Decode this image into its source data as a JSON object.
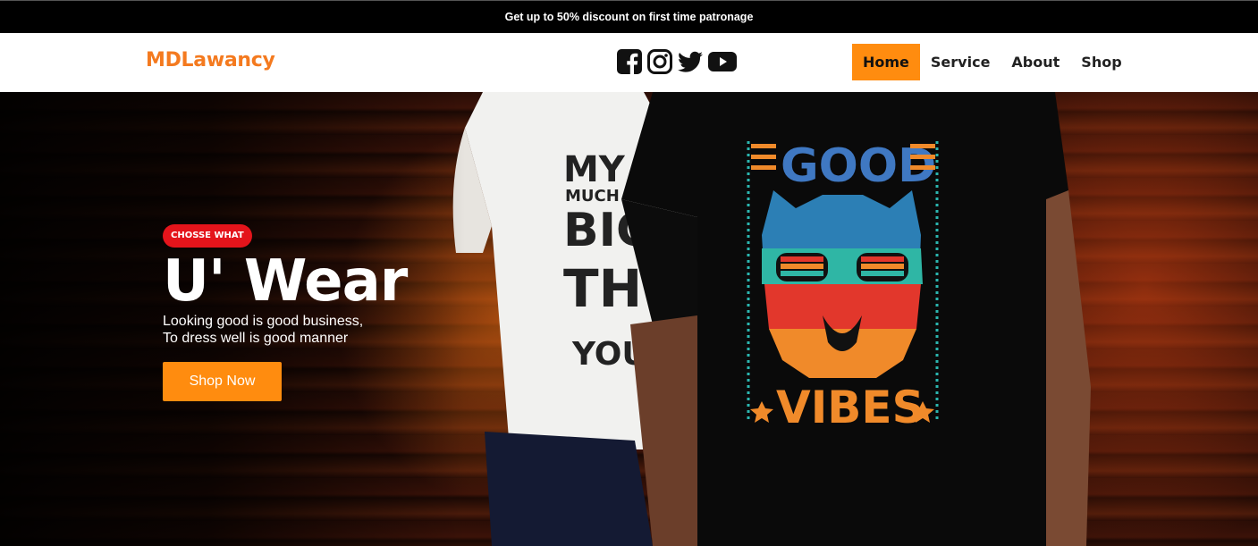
{
  "announcement": "Get up to 50% discount on first time patronage",
  "brand": "MDLawancy",
  "socials": [
    {
      "icon": "facebook-icon"
    },
    {
      "icon": "instagram-icon"
    },
    {
      "icon": "twitter-icon"
    },
    {
      "icon": "youtube-icon"
    }
  ],
  "nav": {
    "items": [
      {
        "label": "Home",
        "active": true
      },
      {
        "label": "Service",
        "active": false
      },
      {
        "label": "About",
        "active": false
      },
      {
        "label": "Shop",
        "active": false
      }
    ]
  },
  "hero": {
    "tag": "CHOSSE WHAT",
    "headline": "U' Wear",
    "line1": "Looking good is good business,",
    "line2": "To dress well is good manner",
    "cta": "Shop Now",
    "shirt_front_top": "GOOD",
    "shirt_front_bottom": "VIBES",
    "shirt_back_lines": [
      "MY",
      "MUCH",
      "BIG",
      "TH",
      "YOU"
    ]
  },
  "colors": {
    "accent": "#ff8c0f",
    "brand": "#f47a1f",
    "tag": "#e4141b",
    "topbar": "#000000"
  }
}
